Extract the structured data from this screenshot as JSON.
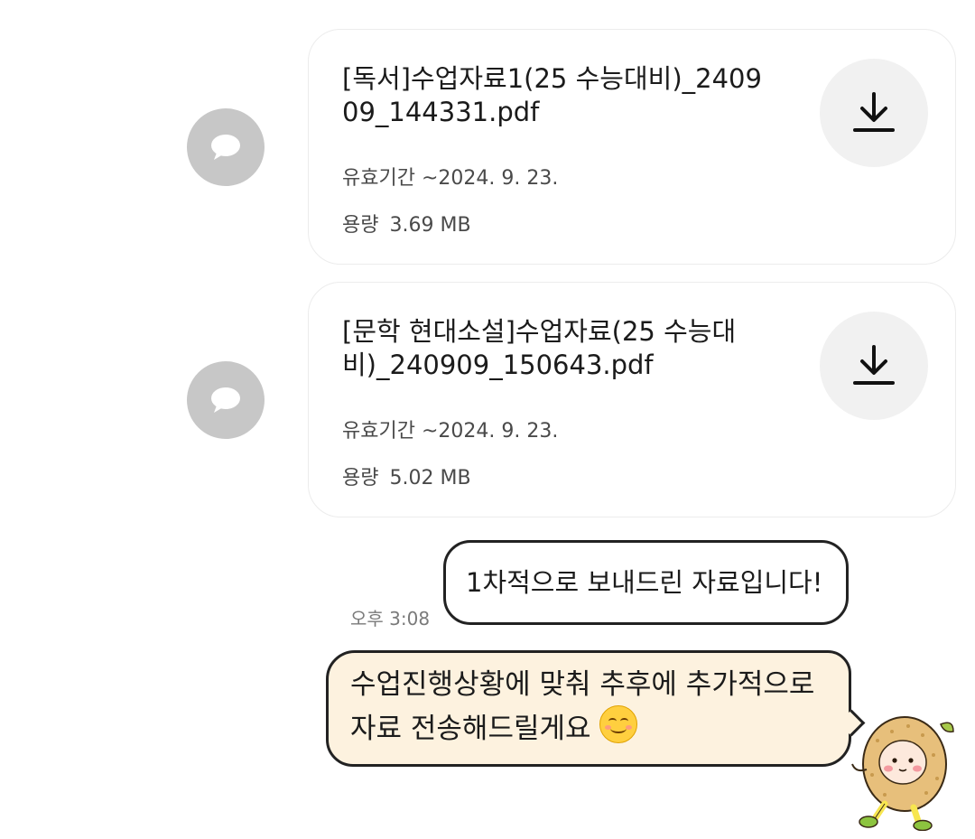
{
  "files": [
    {
      "name": "[독서]수업자료1(25 수능대비)_240909_144331.pdf",
      "expiry_label": "유효기간",
      "expiry_value": "~2024. 9. 23.",
      "size_label": "용량",
      "size_value": "3.69 MB"
    },
    {
      "name": "[문학 현대소설]수업자료(25 수능대비)_240909_150643.pdf",
      "expiry_label": "유효기간",
      "expiry_value": "~2024. 9. 23.",
      "size_label": "용량",
      "size_value": "5.02 MB"
    }
  ],
  "messages": [
    {
      "text": "1차적으로 보내드린 자료입니다!"
    },
    {
      "text": "수업진행상황에 맞춰 추후에 추가적으로 자료 전송해드릴게요"
    }
  ],
  "timestamp": "오후 3:08",
  "icons": {
    "share": "chat-bubble-icon",
    "download": "download-icon",
    "emoji": "smiling-face-emoji",
    "sticker": "citron-character-sticker"
  },
  "colors": {
    "share_button": "#c7c7c7",
    "download_button": "#f1f1f1",
    "highlight_bubble": "#fdf2df",
    "bubble_border": "#222222"
  }
}
